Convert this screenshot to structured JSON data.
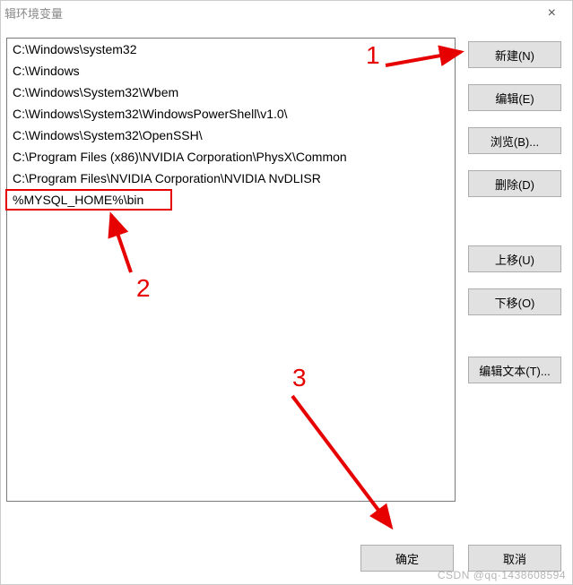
{
  "window": {
    "title": "辑环境变量"
  },
  "list": {
    "items": [
      "C:\\Windows\\system32",
      "C:\\Windows",
      "C:\\Windows\\System32\\Wbem",
      "C:\\Windows\\System32\\WindowsPowerShell\\v1.0\\",
      "C:\\Windows\\System32\\OpenSSH\\",
      "C:\\Program Files (x86)\\NVIDIA Corporation\\PhysX\\Common",
      "C:\\Program Files\\NVIDIA Corporation\\NVIDIA NvDLISR",
      "%MYSQL_HOME%\\bin"
    ]
  },
  "buttons": {
    "new": "新建(N)",
    "edit": "编辑(E)",
    "browse": "浏览(B)...",
    "delete": "删除(D)",
    "moveUp": "上移(U)",
    "moveDown": "下移(O)",
    "editText": "编辑文本(T)...",
    "ok": "确定",
    "cancel": "取消"
  },
  "annotations": {
    "label1": "1",
    "label2": "2",
    "label3": "3"
  },
  "watermark": "CSDN @qq·1438608594"
}
